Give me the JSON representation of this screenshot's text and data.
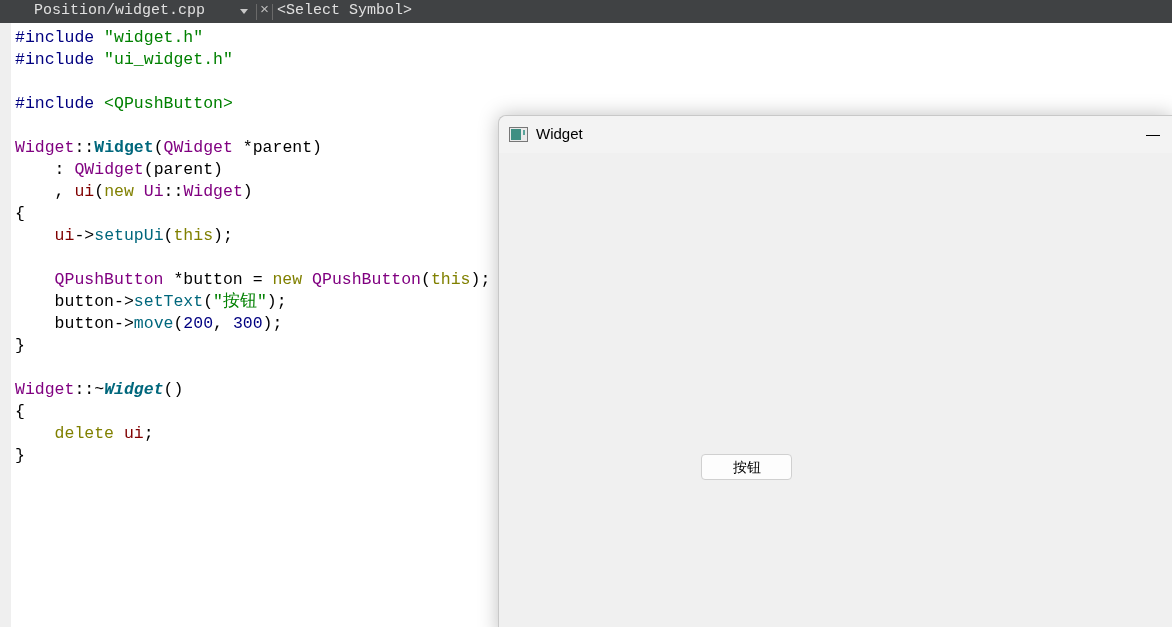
{
  "toolbar": {
    "file_combo": "Position/widget.cpp",
    "close": "×",
    "symbol_combo": "<Select Symbol>"
  },
  "code_lines": [
    {
      "kind": "code",
      "tokens": [
        {
          "kind": "preproc",
          "text": "#include"
        },
        {
          "kind": "string",
          "text": " \"widget.h\""
        }
      ]
    },
    {
      "kind": "code",
      "tokens": [
        {
          "kind": "preproc",
          "text": "#include"
        },
        {
          "kind": "string",
          "text": " \"ui_widget.h\""
        }
      ]
    },
    {
      "kind": "blank"
    },
    {
      "kind": "code",
      "tokens": [
        {
          "kind": "preproc",
          "text": "#include"
        },
        {
          "kind": "string",
          "text": " <QPushButton>"
        }
      ]
    },
    {
      "kind": "blank"
    },
    {
      "kind": "code",
      "tokens": [
        {
          "kind": "type",
          "text": "Widget"
        },
        {
          "kind": "plain",
          "text": "::"
        },
        {
          "kind": "decl",
          "text": "Widget"
        },
        {
          "kind": "plain",
          "text": "("
        },
        {
          "kind": "type",
          "text": "QWidget"
        },
        {
          "kind": "plain",
          "text": " *parent)"
        }
      ]
    },
    {
      "kind": "code",
      "tokens": [
        {
          "kind": "plain",
          "text": "    : "
        },
        {
          "kind": "type",
          "text": "QWidget"
        },
        {
          "kind": "plain",
          "text": "(parent)"
        }
      ]
    },
    {
      "kind": "code",
      "tokens": [
        {
          "kind": "plain",
          "text": "    , "
        },
        {
          "kind": "member",
          "text": "ui"
        },
        {
          "kind": "plain",
          "text": "("
        },
        {
          "kind": "keyword",
          "text": "new"
        },
        {
          "kind": "type",
          "text": " Ui"
        },
        {
          "kind": "plain",
          "text": "::"
        },
        {
          "kind": "type",
          "text": "Widget"
        },
        {
          "kind": "plain",
          "text": ")"
        }
      ]
    },
    {
      "kind": "code",
      "tokens": [
        {
          "kind": "plain",
          "text": "{"
        }
      ]
    },
    {
      "kind": "code",
      "tokens": [
        {
          "kind": "member",
          "text": "    ui"
        },
        {
          "kind": "plain",
          "text": "->"
        },
        {
          "kind": "func",
          "text": "setupUi"
        },
        {
          "kind": "plain",
          "text": "("
        },
        {
          "kind": "keyword",
          "text": "this"
        },
        {
          "kind": "plain",
          "text": ");"
        }
      ]
    },
    {
      "kind": "blank"
    },
    {
      "kind": "code",
      "tokens": [
        {
          "kind": "type",
          "text": "    QPushButton"
        },
        {
          "kind": "plain",
          "text": " *button = "
        },
        {
          "kind": "keyword",
          "text": "new"
        },
        {
          "kind": "type",
          "text": " QPushButton"
        },
        {
          "kind": "plain",
          "text": "("
        },
        {
          "kind": "keyword",
          "text": "this"
        },
        {
          "kind": "plain",
          "text": ");"
        }
      ]
    },
    {
      "kind": "code",
      "tokens": [
        {
          "kind": "plain",
          "text": "    button->"
        },
        {
          "kind": "func",
          "text": "setText"
        },
        {
          "kind": "plain",
          "text": "("
        },
        {
          "kind": "string",
          "text": "\"按钮\""
        },
        {
          "kind": "plain",
          "text": ");"
        }
      ]
    },
    {
      "kind": "code",
      "tokens": [
        {
          "kind": "plain",
          "text": "    button->"
        },
        {
          "kind": "func",
          "text": "move"
        },
        {
          "kind": "plain",
          "text": "("
        },
        {
          "kind": "number",
          "text": "200"
        },
        {
          "kind": "plain",
          "text": ", "
        },
        {
          "kind": "number",
          "text": "300"
        },
        {
          "kind": "plain",
          "text": ");"
        }
      ]
    },
    {
      "kind": "code",
      "tokens": [
        {
          "kind": "plain",
          "text": "}"
        }
      ]
    },
    {
      "kind": "blank"
    },
    {
      "kind": "code",
      "tokens": [
        {
          "kind": "type",
          "text": "Widget"
        },
        {
          "kind": "plain",
          "text": "::~"
        },
        {
          "kind": "decl_italic",
          "text": "Widget"
        },
        {
          "kind": "plain",
          "text": "()"
        }
      ]
    },
    {
      "kind": "code",
      "tokens": [
        {
          "kind": "plain",
          "text": "{"
        }
      ]
    },
    {
      "kind": "code",
      "tokens": [
        {
          "kind": "keyword",
          "text": "    delete"
        },
        {
          "kind": "member",
          "text": " ui"
        },
        {
          "kind": "plain",
          "text": ";"
        }
      ]
    },
    {
      "kind": "code",
      "tokens": [
        {
          "kind": "plain",
          "text": "}"
        }
      ]
    }
  ],
  "widget_window": {
    "title": "Widget",
    "minimize": "—",
    "button": "按钮"
  }
}
